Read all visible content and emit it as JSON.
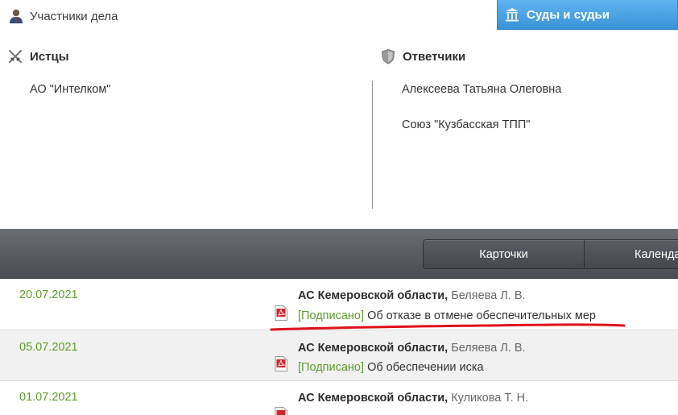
{
  "header": {
    "participants_title": "Участники дела",
    "courts_tab": "Суды и судьи"
  },
  "plaintiffs": {
    "title": "Истцы",
    "items": [
      "АО \"Интелком\""
    ]
  },
  "defendants": {
    "title": "Ответчики",
    "items": [
      "Алексеева Татьяна Олеговна",
      "Союз \"Кузбасская ТПП\""
    ]
  },
  "toolbar": {
    "cards_label": "Карточки",
    "calendar_label": "Календарь"
  },
  "documents": [
    {
      "date": "20.07.2021",
      "court": "АС Кемеровской области,",
      "judge": "Беляева Л. В.",
      "status": "[Подписано]",
      "title": "Об отказе в отмене обеспечительных мер"
    },
    {
      "date": "05.07.2021",
      "court": "АС Кемеровской области,",
      "judge": "Беляева Л. В.",
      "status": "[Подписано]",
      "title": "Об обеспечении иска"
    },
    {
      "date": "01.07.2021",
      "court": "АС Кемеровской области,",
      "judge": "Куликова Т. Н.",
      "status": "",
      "title": ""
    }
  ],
  "colors": {
    "accent_blue": "#3a93d8",
    "date_green": "#5a9e2a",
    "toolbar_dark": "#4a4d52",
    "annotation_red": "#e0101a"
  },
  "icons": {
    "participants": "user-icon",
    "courts": "courthouse-icon",
    "plaintiffs": "crossed-swords-icon",
    "defendants": "shield-icon",
    "document": "pdf-icon"
  }
}
